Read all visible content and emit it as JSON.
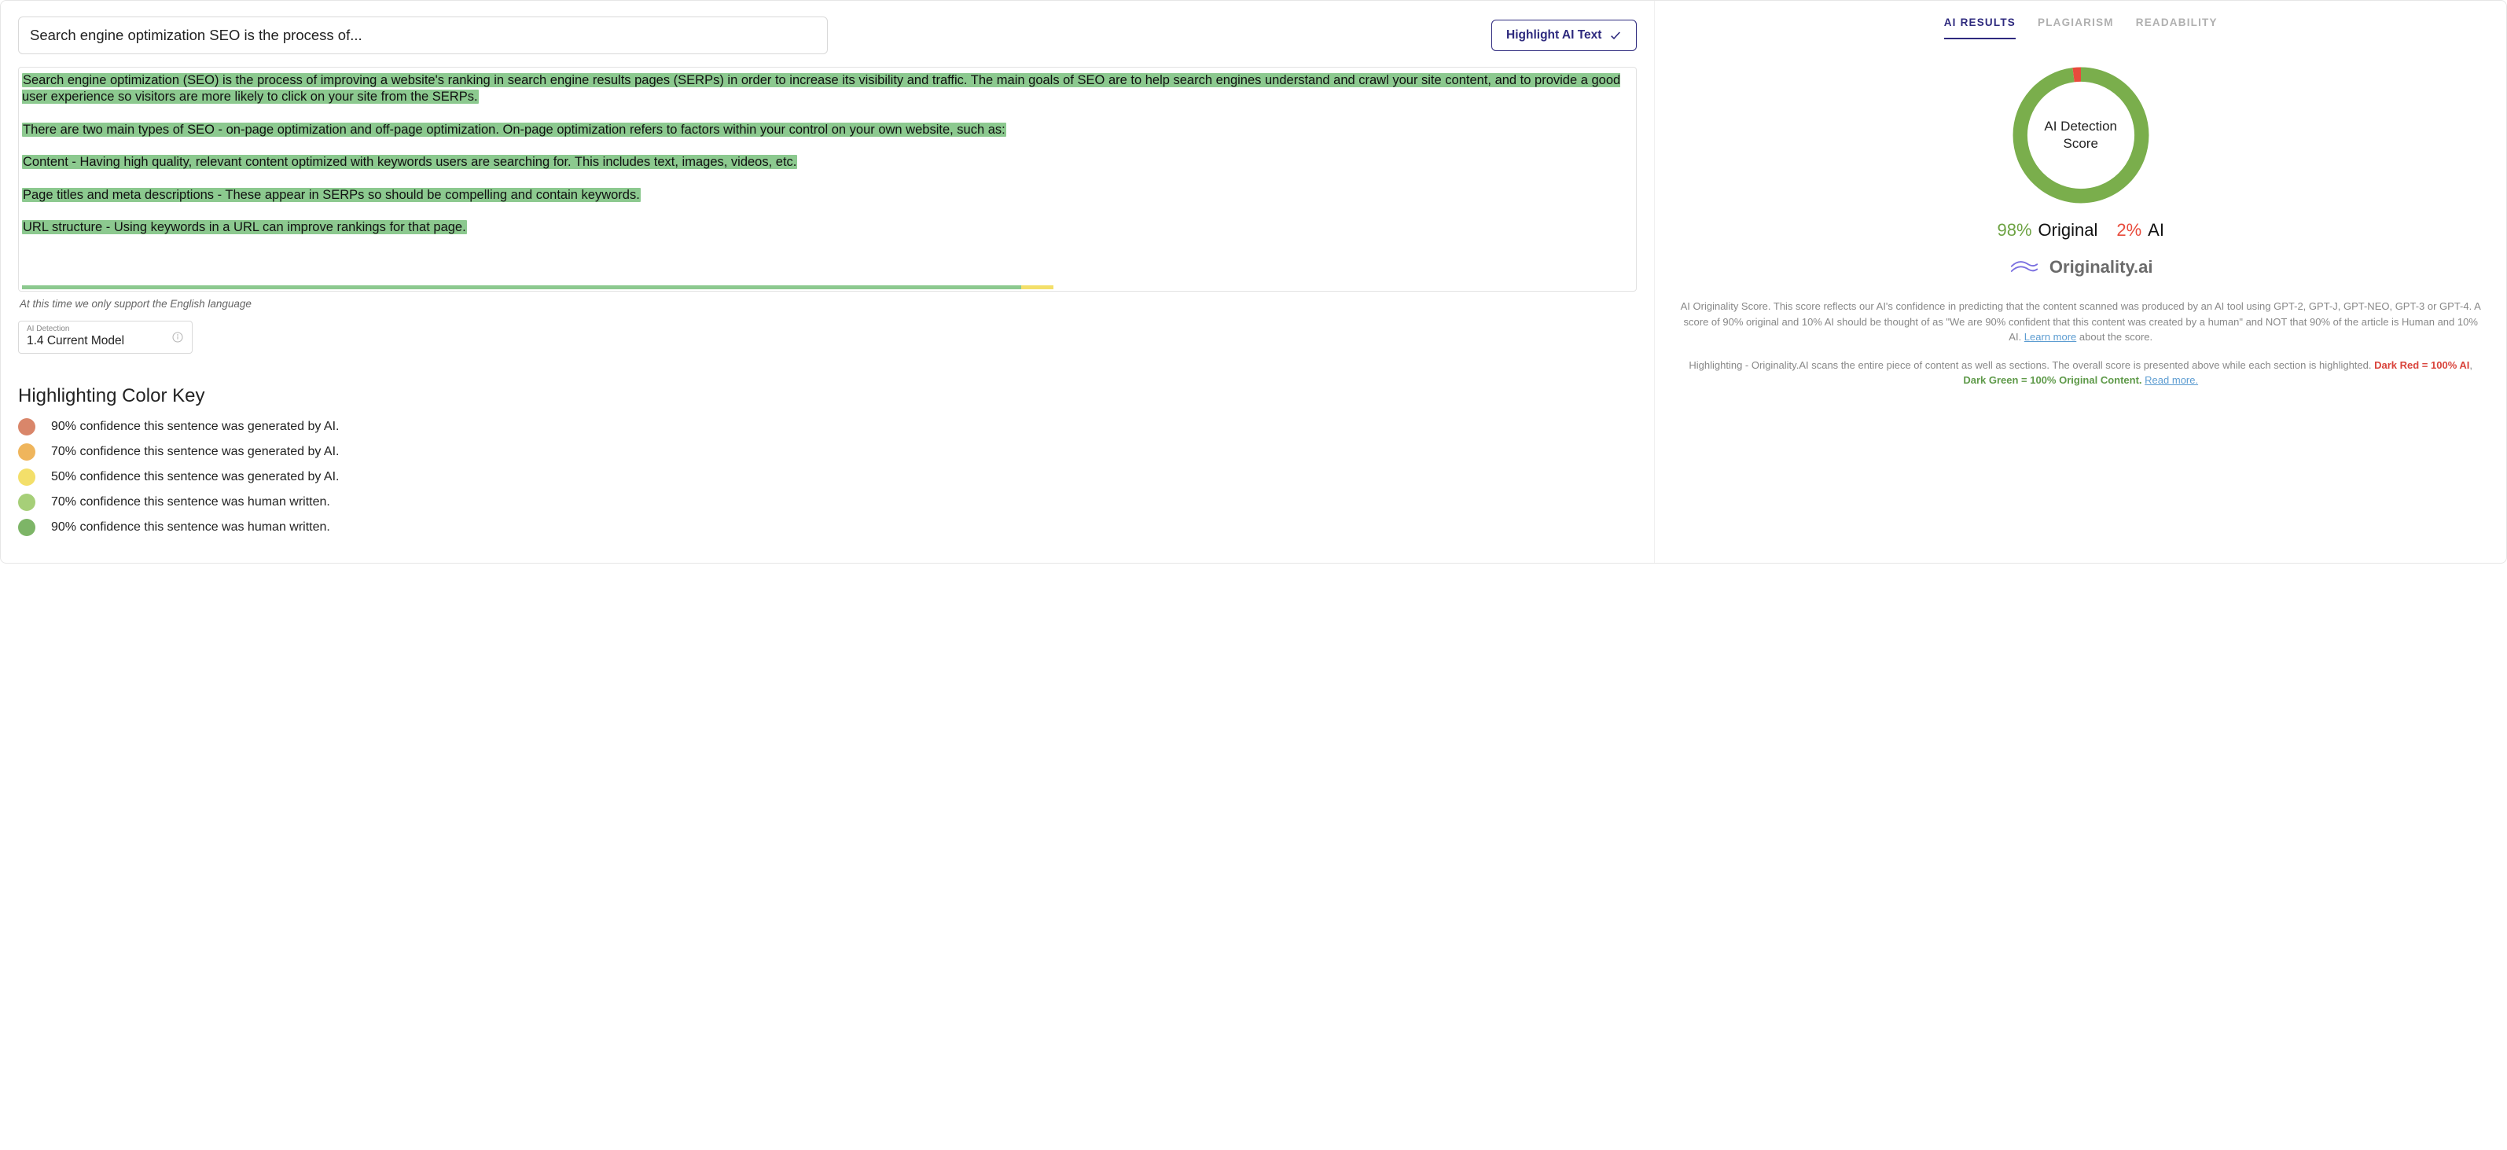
{
  "header": {
    "title_value": "Search engine optimization SEO is the process of...",
    "highlight_button": "Highlight AI Text"
  },
  "content": {
    "p1": "Search engine optimization (SEO) is the process of improving a website's ranking in search engine results pages (SERPs) in order to increase its visibility and traffic. The main goals of SEO are to help search engines understand and crawl your site content, and to provide a good user experience so visitors are more likely to click on your site from the SERPs.",
    "p2": "There are two main types of SEO - on-page optimization and off-page optimization. On-page optimization refers to factors within your control on your own website, such as:",
    "p3": "Content - Having high quality, relevant content optimized with keywords users are searching for. This includes text, images, videos, etc.",
    "p4": "Page titles and meta descriptions - These appear in SERPs so should be compelling and contain keywords.",
    "p5": "URL structure - Using keywords in a URL can improve rankings for that page."
  },
  "note": "At this time we only support the English language",
  "model": {
    "label": "AI Detection",
    "value": "1.4 Current Model"
  },
  "color_key": {
    "title": "Highlighting Color Key",
    "items": [
      {
        "color": "#d9866a",
        "text": "90% confidence this sentence was generated by AI."
      },
      {
        "color": "#efb55c",
        "text": "70% confidence this sentence was generated by AI."
      },
      {
        "color": "#f3df6a",
        "text": "50% confidence this sentence was generated by AI."
      },
      {
        "color": "#a6cf78",
        "text": "70% confidence this sentence was human written."
      },
      {
        "color": "#7db567",
        "text": "90% confidence this sentence was human written."
      }
    ]
  },
  "tabs": {
    "ai": "AI RESULTS",
    "plag": "PLAGIARISM",
    "read": "READABILITY"
  },
  "donut": {
    "label_l1": "AI Detection",
    "label_l2": "Score",
    "original_pct": "98%",
    "original_label": "Original",
    "ai_pct": "2%",
    "ai_label": "AI",
    "green_color": "#7aae4c",
    "red_color": "#e84b3c"
  },
  "brand": {
    "name": "Originality.ai"
  },
  "desc1_a": "AI Originality Score. This score reflects our AI's confidence in predicting that the content scanned was produced by an AI tool using GPT-2, GPT-J, GPT-NEO, GPT-3 or GPT-4. A score of 90% original and 10% AI should be thought of as \"We are 90% confident that this content was created by a human\" and NOT that 90% of the article is Human and 10% AI. ",
  "desc1_link": "Learn more",
  "desc1_b": " about the score.",
  "desc2_a": "Highlighting - Originality.AI scans the entire piece of content as well as sections. The overall score is presented above while each section is highlighted. ",
  "desc2_red": "Dark Red = 100% AI",
  "desc2_sep": ", ",
  "desc2_green": "Dark Green = 100% Original Content.",
  "desc2_link": "Read more.",
  "chart_data": {
    "type": "pie",
    "title": "AI Detection Score",
    "series": [
      {
        "name": "Original",
        "value": 98,
        "color": "#7aae4c"
      },
      {
        "name": "AI",
        "value": 2,
        "color": "#e84b3c"
      }
    ]
  }
}
